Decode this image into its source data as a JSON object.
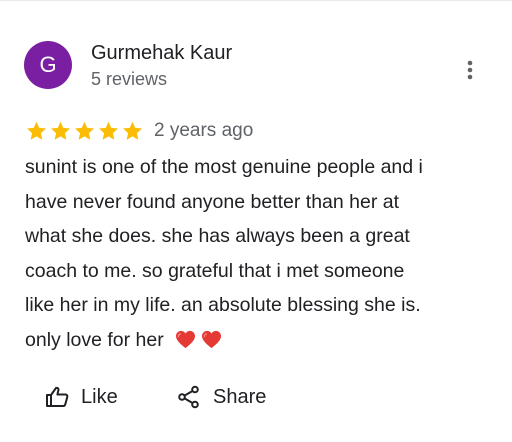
{
  "reviewer": {
    "initial": "G",
    "name": "Gurmehak Kaur",
    "reviews_count": "5 reviews",
    "avatar_color": "#7b1fa2"
  },
  "review": {
    "rating": 5,
    "max_rating": 5,
    "date": "2 years ago",
    "lines": [
      "sunint is one of the most genuine people and i",
      "have never found anyone better than her at",
      "what she does. she has always been a great",
      "coach to me. so grateful that i met someone",
      "like her in my life. an absolute blessing she is.",
      "only love for her"
    ],
    "emoji": [
      "red-heart",
      "red-heart"
    ]
  },
  "actions": {
    "like_label": "Like",
    "share_label": "Share"
  },
  "icons": {
    "more": "more-vertical-icon",
    "like": "thumbs-up-icon",
    "share": "share-icon",
    "star": "star-icon"
  },
  "colors": {
    "star": "#fbbc04",
    "heart": "#e53935"
  }
}
